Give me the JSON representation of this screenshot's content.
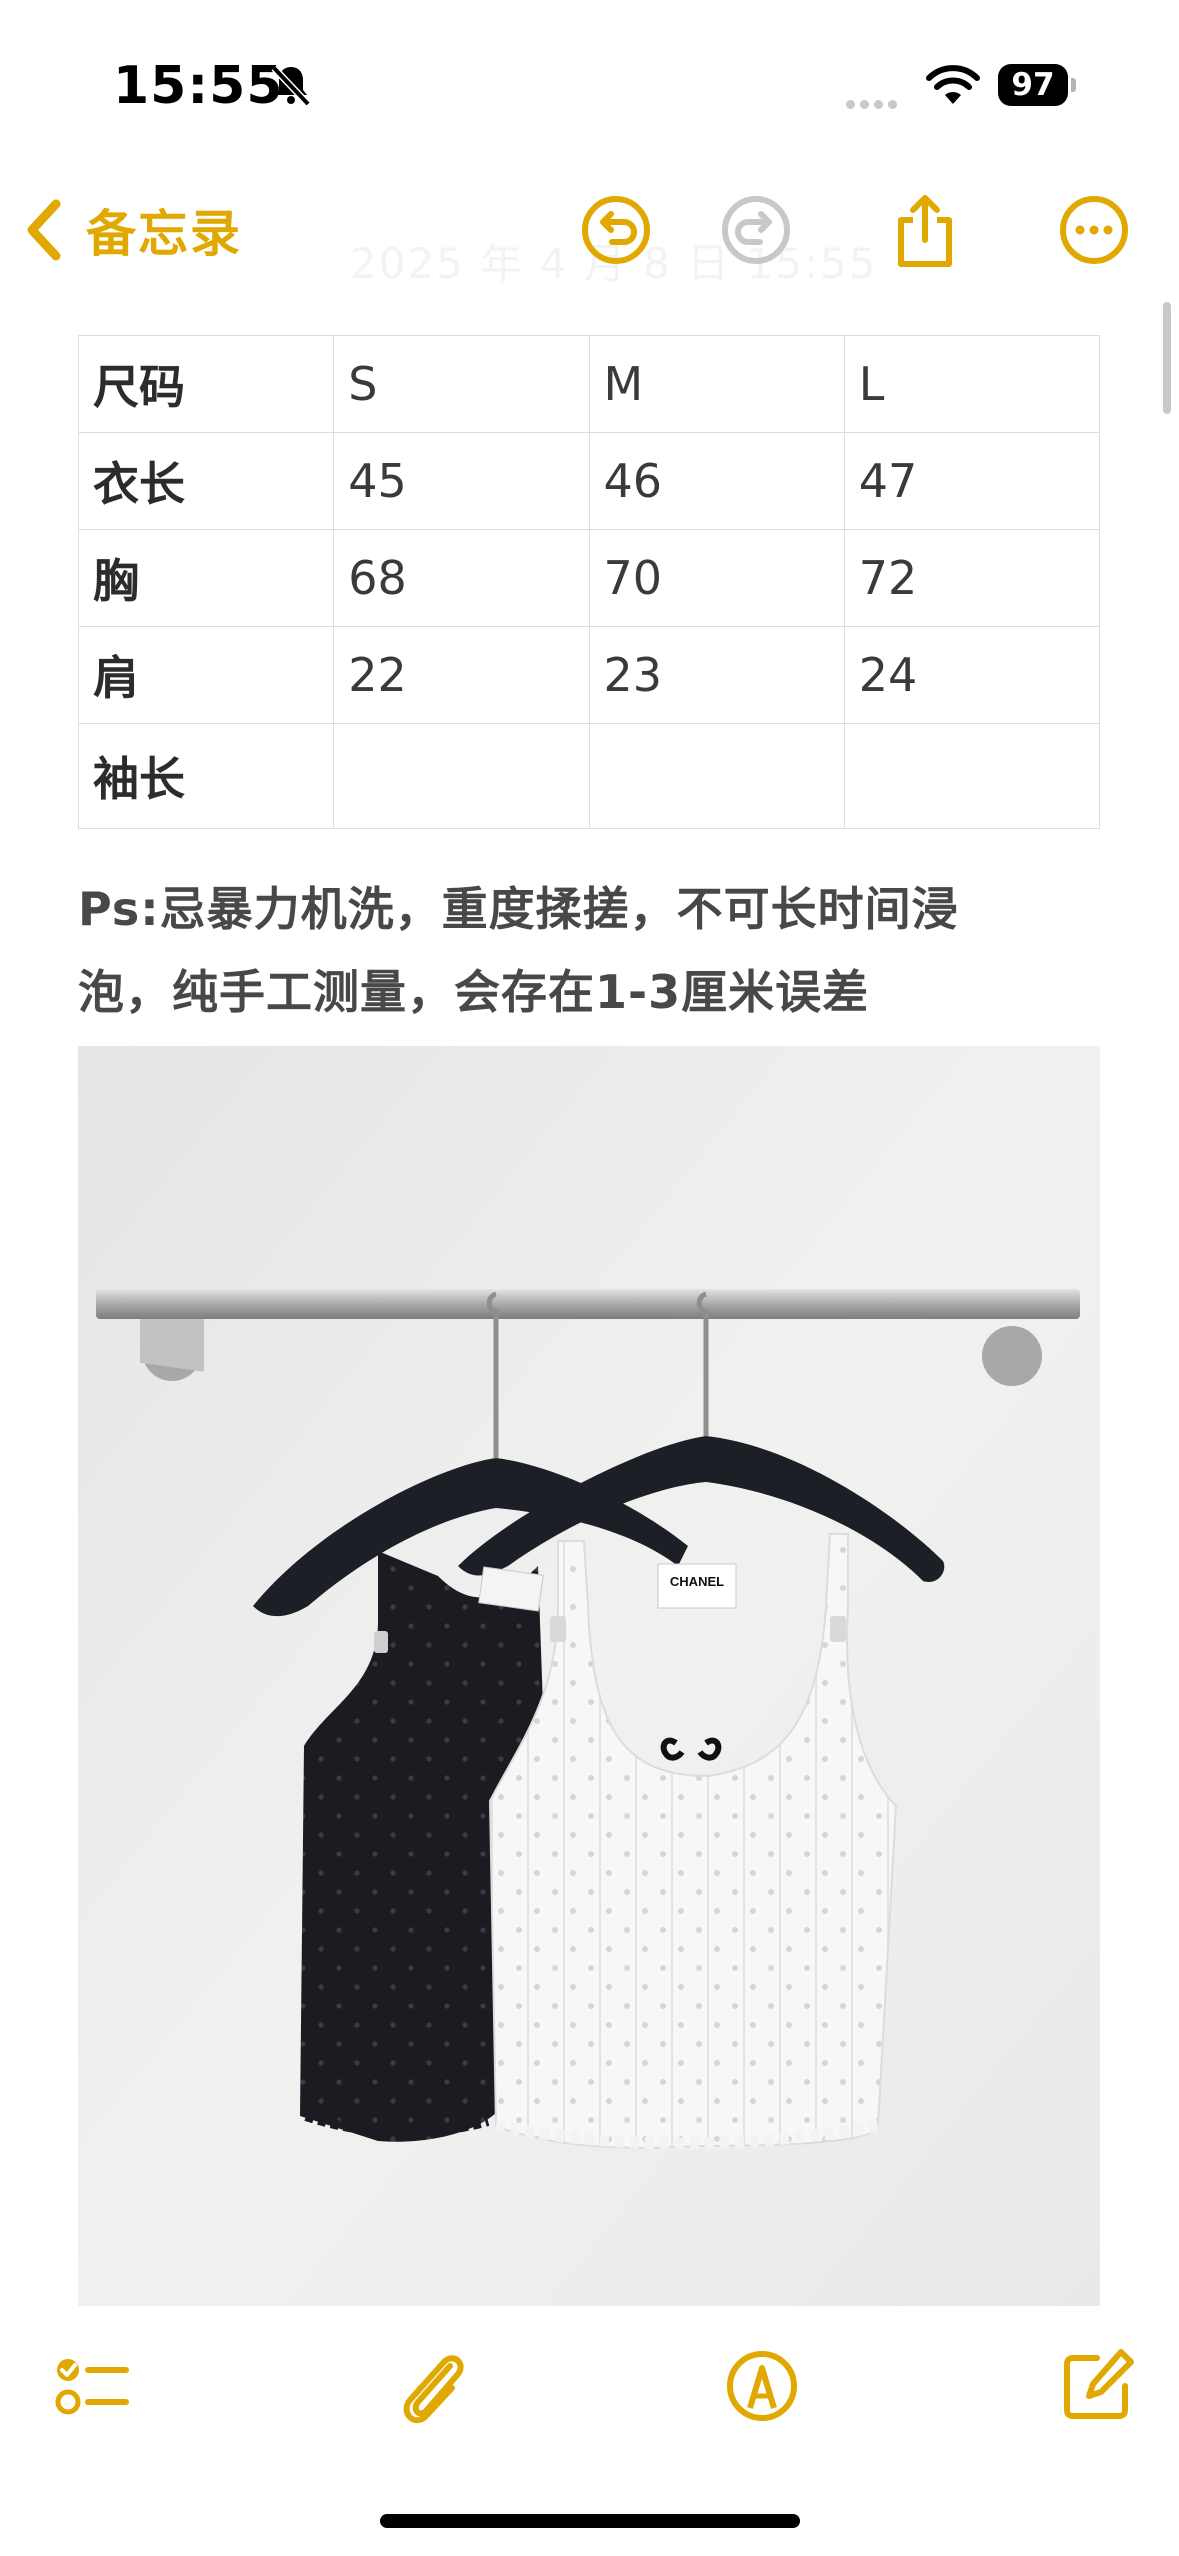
{
  "status_bar": {
    "time": "15:55",
    "battery_level": "97",
    "icons": [
      "bell-slash-icon",
      "cellular-icon",
      "wifi-icon",
      "battery-icon"
    ]
  },
  "nav": {
    "back_label": "备忘录",
    "date_text": "2025 年 4 月 8 日 15:55",
    "actions": [
      "undo-icon",
      "redo-icon",
      "share-icon",
      "more-icon"
    ]
  },
  "size_table": {
    "rows": [
      {
        "label": "尺码",
        "values": [
          "S",
          "M",
          "L"
        ]
      },
      {
        "label": "衣长",
        "values": [
          "45",
          "46",
          "47"
        ]
      },
      {
        "label": "胸",
        "values": [
          "68",
          "70",
          "72"
        ]
      },
      {
        "label": "肩",
        "values": [
          "22",
          "23",
          "24"
        ]
      },
      {
        "label": "袖长",
        "values": [
          "",
          "",
          ""
        ]
      }
    ]
  },
  "note": {
    "line1": "Ps:忌暴力机洗，重度揉搓，不可长时间浸",
    "line2": "泡，纯手工测量，会存在1-3厘米误差"
  },
  "photo": {
    "tag_brand": "CHANEL",
    "description_icon": "product-photo"
  },
  "toolbar": {
    "items": [
      "checklist-icon",
      "attachment-icon",
      "markup-icon",
      "compose-icon"
    ]
  },
  "colors": {
    "accent": "#E0A800",
    "disabled": "#C7C7CC",
    "background": "#FFFFFF",
    "text": "#3A3A3C"
  }
}
